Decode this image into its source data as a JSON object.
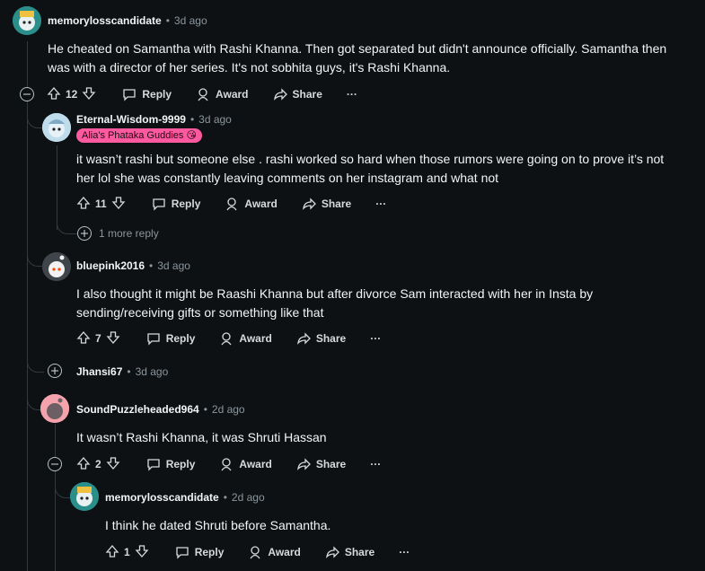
{
  "actions": {
    "reply": "Reply",
    "award": "Award",
    "share": "Share",
    "more": "···"
  },
  "comments": [
    {
      "username": "memorylosscandidate",
      "time": "3d ago",
      "body": "He cheated on Samantha with Rashi Khanna. Then got separated but didn't announce officially. Samantha then was with a director of her series. It's not sobhita guys, it's Rashi Khanna.",
      "score": "12"
    },
    {
      "username": "Eternal-Wisdom-9999",
      "time": "3d ago",
      "flair": "Alia's Phataka Guddies 😘",
      "body": "it wasn’t rashi but someone else . rashi worked so hard when those rumors were going on to prove it’s not her lol she was constantly leaving comments on her instagram and what not",
      "score": "11",
      "more_replies": "1 more reply"
    },
    {
      "username": "bluepink2016",
      "time": "3d ago",
      "body": "I also thought it might be Raashi Khanna but after divorce Sam interacted with her in Insta by sending/receiving gifts or something like that",
      "score": "7"
    },
    {
      "username": "Jhansi67",
      "time": "3d ago"
    },
    {
      "username": "SoundPuzzleheaded964",
      "time": "2d ago",
      "body": "It wasn’t Rashi Khanna, it was Shruti Hassan",
      "score": "2"
    },
    {
      "username": "memorylosscandidate",
      "time": "2d ago",
      "body": "I think he dated Shruti before Samantha.",
      "score": "1"
    }
  ],
  "colors": {
    "background": "#0e1113",
    "thread_line": "#33393d",
    "flair_bg": "#ff5aa0",
    "muted": "#8b969d"
  }
}
